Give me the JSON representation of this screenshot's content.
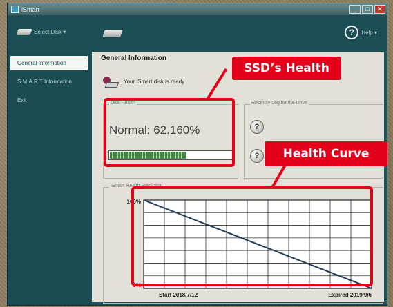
{
  "window": {
    "title": "iSmart",
    "controls": [
      "_",
      "□",
      "✕"
    ]
  },
  "toolbar": {
    "select_disk_label": "Select Disk ▾",
    "help_label": "Help ▾",
    "icons": [
      "disk-icon",
      "drive-icon",
      "help-icon"
    ]
  },
  "sidebar": {
    "items": [
      {
        "label": "General Information",
        "active": true
      },
      {
        "label": "S.M.A.R.T Information",
        "active": false
      },
      {
        "label": "Exit",
        "active": false
      }
    ]
  },
  "main": {
    "title": "General Information",
    "status_text": "Your iSmart disk is ready",
    "health": {
      "group_label": "Disk Health",
      "value_text": "Normal: 62.160%",
      "progress": 0.6216
    },
    "log": {
      "group_label": "Recently Log for the Drive"
    },
    "prediction": {
      "group_label": "iSmart Health Prediction"
    }
  },
  "callouts": {
    "health": "SSD’s Health",
    "curve": "Health Curve"
  },
  "colors": {
    "callout": "#e4001b",
    "curve_line": "#1f3d56",
    "progress_fill": "#3e8a44"
  },
  "chart_data": {
    "type": "line",
    "title": "",
    "xlabel": "",
    "ylabel": "",
    "x": [
      "2018/7/12",
      "2019/9/6"
    ],
    "x_tick_labels": [
      "Start 2018/7/12",
      "Expired 2019/9/6"
    ],
    "y_tick_labels": [
      "100%",
      "0%"
    ],
    "ylim": [
      0,
      100
    ],
    "series": [
      {
        "values": [
          100,
          0
        ]
      }
    ],
    "grid": true,
    "grid_columns": 11,
    "grid_rows": 7
  }
}
